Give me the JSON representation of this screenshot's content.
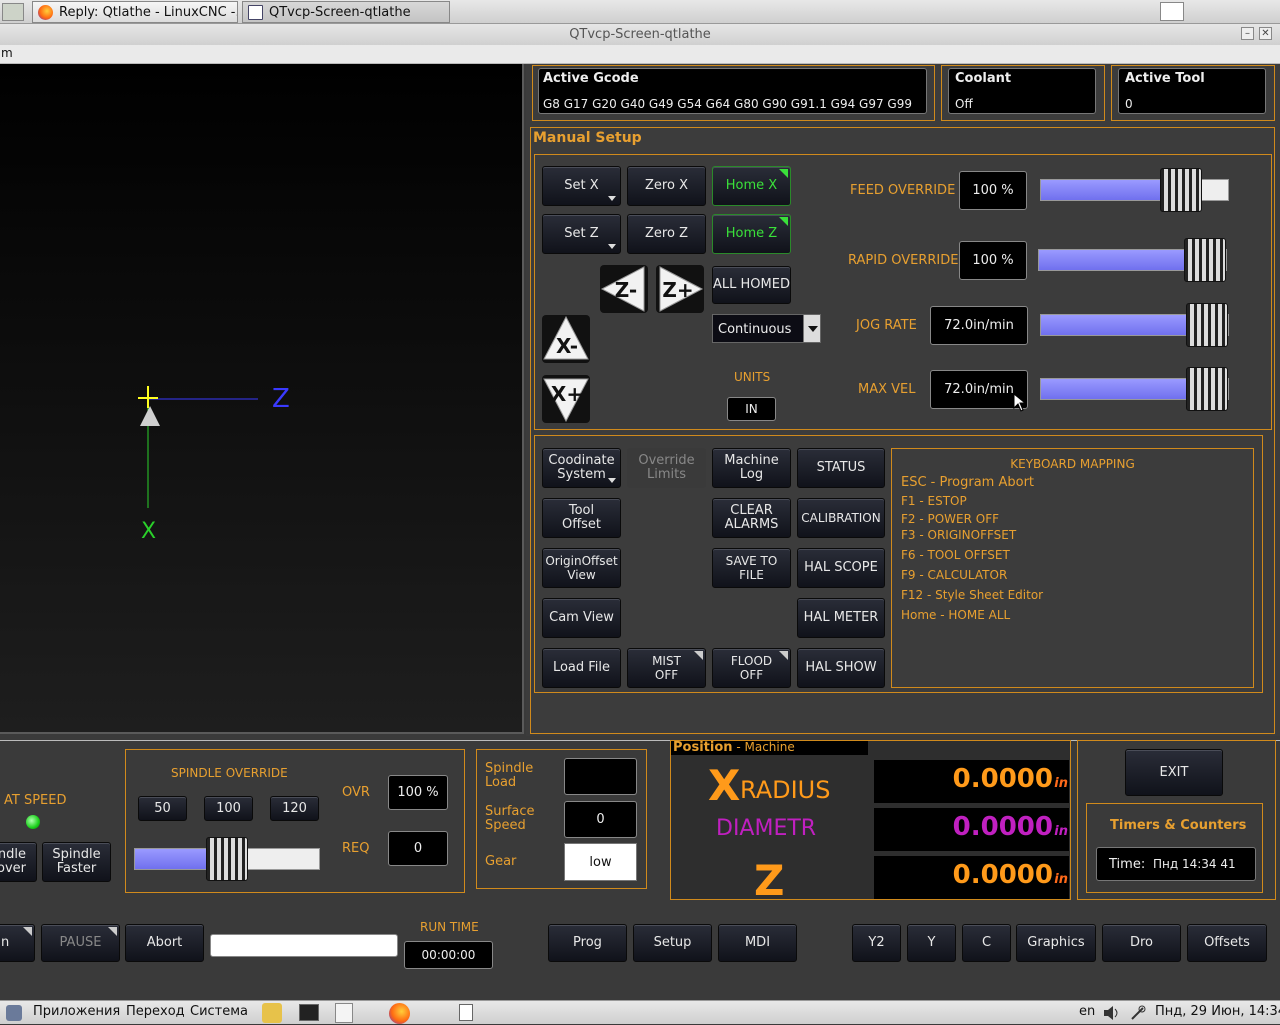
{
  "taskbar": {
    "tabs": [
      "Reply: Qtlathe - LinuxCNC -...",
      "QTvcp-Screen-qtlathe"
    ]
  },
  "window": {
    "title": "QTvcp-Screen-qtlathe",
    "menu_fragment": "m"
  },
  "graphics": {
    "axis_z": "Z",
    "axis_x": "X"
  },
  "active_gcode": {
    "label": "Active Gcode",
    "value": "G8 G17 G20 G40 G49 G54 G64 G80 G90 G91.1 G94 G97 G99"
  },
  "coolant": {
    "label": "Coolant",
    "value": "Off"
  },
  "active_tool": {
    "label": "Active Tool",
    "value": "0"
  },
  "manual_setup": {
    "title": "Manual Setup",
    "set_x": "Set X",
    "zero_x": "Zero X",
    "home_x": "Home X",
    "set_z": "Set Z",
    "zero_z": "Zero Z",
    "home_z": "Home Z",
    "all_homed": "ALL HOMED",
    "jog_mode": "Continuous",
    "units_label": "UNITS",
    "units_value": "IN",
    "feed_override_label": "FEED OVERRIDE",
    "feed_override_value": "100 %",
    "feed_override_fraction": 0.75,
    "rapid_override_label": "RAPID OVERRIDE",
    "rapid_override_value": "100 %",
    "rapid_override_fraction": 1.0,
    "jog_rate_label": "JOG RATE",
    "jog_rate_value": "72.0in/min",
    "jog_rate_fraction": 1.0,
    "max_vel_label": "MAX VEL",
    "max_vel_value": "72.0in/min",
    "max_vel_fraction": 1.0
  },
  "tools": {
    "coord_system": "Coodinate System",
    "override_limits": "Override Limits",
    "machine_log": "Machine Log",
    "status": "STATUS",
    "tool_offset": "Tool Offset",
    "clear_alarms": "CLEAR ALARMS",
    "calibration": "CALIBRATION",
    "origin_offset_view": "OriginOffset View",
    "save_to_file": "SAVE TO FILE",
    "hal_scope": "HAL SCOPE",
    "cam_view": "Cam View",
    "hal_meter": "HAL METER",
    "load_file": "Load File",
    "mist_off": "MIST OFF",
    "flood_off": "FLOOD OFF",
    "hal_show": "HAL SHOW"
  },
  "keyboard_mapping": {
    "title": "KEYBOARD MAPPING",
    "items": [
      "ESC - Program Abort",
      "F1 - ESTOP",
      "F2 - POWER OFF",
      "F3 - ORIGINOFFSET",
      "F6 - TOOL OFFSET",
      "F9 - CALCULATOR",
      "F12 - Style Sheet Editor",
      "Home - HOME ALL"
    ]
  },
  "spindle": {
    "at_speed": "AT SPEED",
    "slower": "ndle\nover",
    "faster": "Spindle Faster",
    "override_title": "SPINDLE OVERRIDE",
    "presets": [
      "50",
      "100",
      "120"
    ],
    "ovr_label": "OVR",
    "ovr_value": "100 %",
    "req_label": "REQ",
    "req_value": "0",
    "override_fraction": 0.5,
    "load_label": "Spindle Load",
    "load_value": "",
    "surface_label": "Surface Speed",
    "surface_value": "0",
    "gear_label": "Gear",
    "gear_value": "low"
  },
  "position": {
    "title": "Position",
    "mode": "- Machine",
    "axes": [
      {
        "letter": "X",
        "sub": "RADIUS",
        "value": "0.0000",
        "unit": "in",
        "color": "#ff9a1a"
      },
      {
        "letter": "",
        "sub": "DIAMETR",
        "value": "0.0000",
        "unit": "in",
        "color": "#c020c0"
      },
      {
        "letter": "Z",
        "sub": "",
        "value": "0.0000",
        "unit": "in",
        "color": "#ff9a1a"
      }
    ]
  },
  "right_panel": {
    "exit": "EXIT",
    "timers_title": "Timers & Counters",
    "time_label": "Time:",
    "time_value": "Пнд 14:34 41"
  },
  "bottom": {
    "run_fragment": "n",
    "pause": "PAUSE",
    "abort": "Abort",
    "run_time_label": "RUN TIME",
    "run_time_value": "00:00:00",
    "tabs_left": [
      "Prog",
      "Setup",
      "MDI"
    ],
    "tabs_right": [
      "Y2",
      "Y",
      "C",
      "Graphics",
      "Dro",
      "Offsets"
    ]
  },
  "os_panel": {
    "apps": "Приложения",
    "go": "Переход",
    "system": "Система",
    "lang": "en",
    "datetime": "Пнд, 29 Июн, 14:34"
  }
}
